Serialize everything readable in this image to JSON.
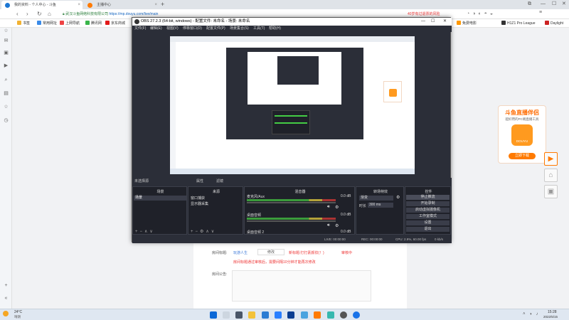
{
  "browser": {
    "tabs": [
      {
        "title": "我的资料 - 个人中心 - 斗鱼",
        "active": true
      },
      {
        "title": "主播中心",
        "active": false
      }
    ],
    "new_tab_symbol": "+",
    "url_site": "武汉斗鱼网络科技有限公司",
    "url_path": "https://mp.douyu.com/live/main",
    "search_hint": "40岁有过退票的风险",
    "bookmarks": [
      "书签",
      "常用网址",
      "上网导航",
      "腾讯网",
      "京东商城"
    ],
    "bookmarks_right": [
      "免费电影",
      "H1Z1 Pro League",
      "Daylight"
    ]
  },
  "page_form": {
    "title_label": "房间标题:",
    "title_value": "玩游人生",
    "edit_label": "修改",
    "warning1": "新标题:打打素颜妆(！)",
    "warning_tail": "审核中",
    "warning2": "房间标题通过审核后，需要间隔10分钟才能再次修改",
    "notice_label": "房间公告:"
  },
  "obs": {
    "title": "OBS 27.2.3 (64-bit, windows) - 配置文件: 未命名 - 场景: 未命名",
    "menu": [
      "文件(F)",
      "编辑(E)",
      "视图(V)",
      "停靠窗口(D)",
      "配置文件(P)",
      "场景集合(S)",
      "工具(T)",
      "帮助(H)"
    ],
    "unselected_source": "未选择源",
    "props_label": "属性",
    "filters_label": "滤镜",
    "docks": {
      "scenes_header": "场景",
      "scene_item": "场景",
      "sources_header": "来源",
      "sources": [
        "窗口捕获",
        "显示器采集"
      ],
      "mixer_header": "混音器",
      "mixer_tracks": [
        {
          "name": "麦克风/Aux",
          "db": "0.0 dB"
        },
        {
          "name": "桌面音频",
          "db": "0.0 dB"
        },
        {
          "name": "桌面音频 2",
          "db": "0.0 dB"
        }
      ],
      "transitions_header": "转场特效",
      "transition_value": "渐变",
      "duration_label": "时长",
      "duration_value": "300 ms",
      "controls_header": "控件",
      "controls": [
        "停止推流",
        "开始录制",
        "启动虚拟摄像机",
        "工作室模式",
        "设置",
        "退出"
      ]
    },
    "status": {
      "live_label": "LIVE: 00:00:00",
      "rec_label": "REC: 00:00:00",
      "cpu": "CPU: 2.9%, 60.00 fps",
      "kbps": "0 kb/s"
    }
  },
  "promo": {
    "title": "斗鱼直播伴侣",
    "subtitle": "超好用的PC端直播工具",
    "download": "立即下载",
    "app_name": "DOUYU"
  },
  "taskbar": {
    "weather": "24°C",
    "weather_desc": "晴朗",
    "time": "15:28",
    "date": "2022/5/15"
  }
}
